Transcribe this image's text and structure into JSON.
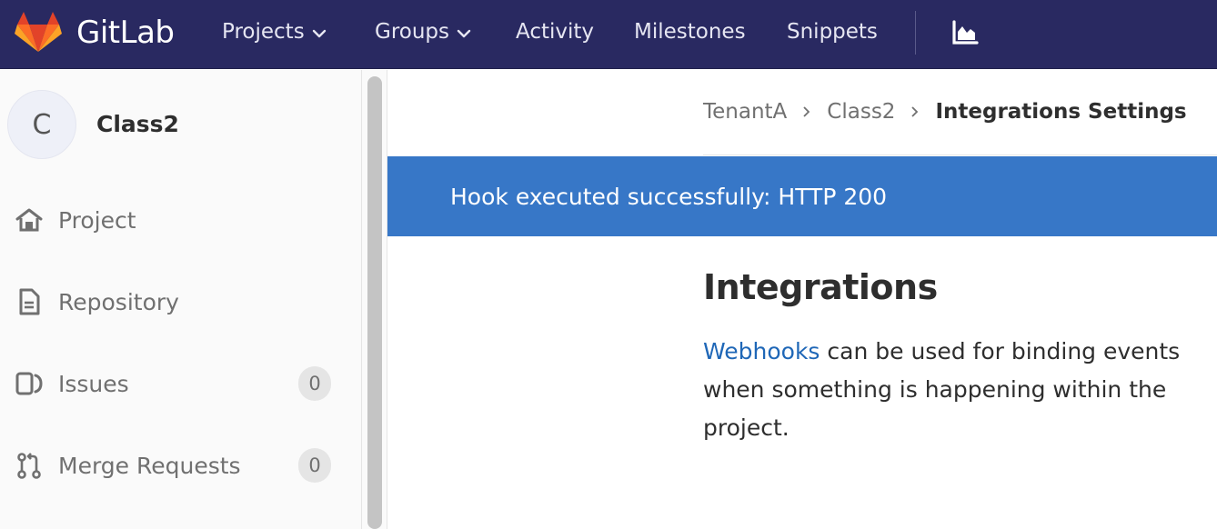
{
  "navbar": {
    "brand": "GitLab",
    "items": [
      {
        "label": "Projects",
        "dropdown": true
      },
      {
        "label": "Groups",
        "dropdown": true
      },
      {
        "label": "Activity",
        "dropdown": false
      },
      {
        "label": "Milestones",
        "dropdown": false
      },
      {
        "label": "Snippets",
        "dropdown": false
      }
    ],
    "icons": [
      "gitlab-logo-icon",
      "chart-icon"
    ]
  },
  "sidebar": {
    "avatar_letter": "C",
    "project_name": "Class2",
    "items": [
      {
        "label": "Project",
        "icon": "home-icon"
      },
      {
        "label": "Repository",
        "icon": "document-icon"
      },
      {
        "label": "Issues",
        "icon": "issues-icon",
        "count": "0"
      },
      {
        "label": "Merge Requests",
        "icon": "merge-request-icon",
        "count": "0"
      }
    ]
  },
  "breadcrumb": {
    "items": [
      "TenantA",
      "Class2"
    ],
    "current": "Integrations Settings"
  },
  "flash": {
    "message": "Hook executed successfully: HTTP 200"
  },
  "main": {
    "title": "Integrations",
    "description_link": "Webhooks",
    "description_text": " can be used for binding events when something is happening within the project."
  },
  "colors": {
    "navbar_bg": "#292961",
    "flash_bg": "#3777c7",
    "link": "#1f67b7"
  }
}
